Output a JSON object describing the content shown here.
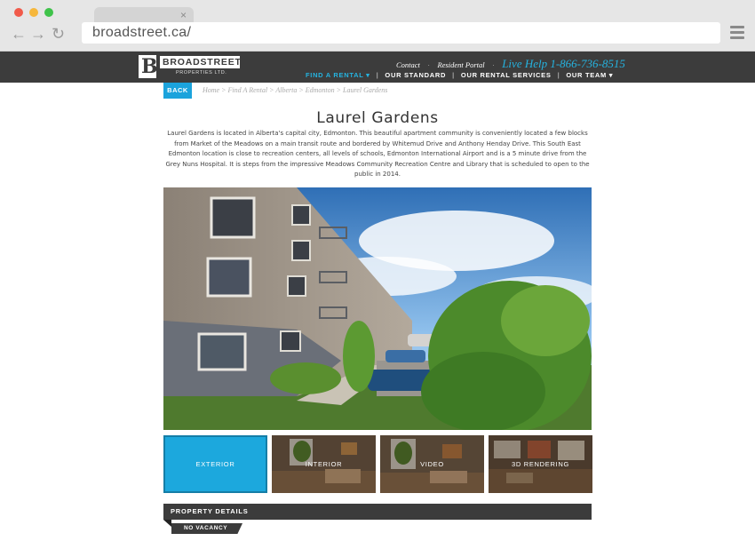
{
  "browser": {
    "url": "broadstreet.ca/",
    "tab_close": "×"
  },
  "logo": {
    "mark": "B",
    "name": "BROADSTREET",
    "sub": "PROPERTIES LTD."
  },
  "top_links": {
    "contact": "Contact",
    "resident_portal": "Resident Portal",
    "separator": "·",
    "live_help": "Live Help 1-866-736-8515"
  },
  "main_nav": [
    {
      "label": "FIND A RENTAL ▾"
    },
    {
      "label": "OUR STANDARD"
    },
    {
      "label": "OUR RENTAL SERVICES"
    },
    {
      "label": "OUR TEAM ▾"
    }
  ],
  "back_button": "BACK",
  "breadcrumb": "Home > Find A Rental > Alberta > Edmonton > Laurel Gardens",
  "page_title": "Laurel Gardens",
  "description": "Laurel Gardens is located in Alberta's capital city, Edmonton. This beautiful apartment community is conveniently located a few blocks from Market of the Meadows on a main transit route and bordered by Whitemud Drive and Anthony Henday Drive. This South East Edmonton location is close to recreation centers, all levels of schools, Edmonton International Airport and is a 5 minute drive from the Grey Nuns Hospital. It is steps from the impressive Meadows Community Recreation Centre and Library that is scheduled to open to the public in 2014.",
  "thumbnails": [
    {
      "label": "EXTERIOR"
    },
    {
      "label": "INTERIOR"
    },
    {
      "label": "VIDEO"
    },
    {
      "label": "3D RENDERING"
    }
  ],
  "details": {
    "title": "PROPERTY DETAILS",
    "vacancy": "NO VACANCY"
  },
  "colors": {
    "accent": "#1ba3dc",
    "header": "#3c3c3c"
  }
}
